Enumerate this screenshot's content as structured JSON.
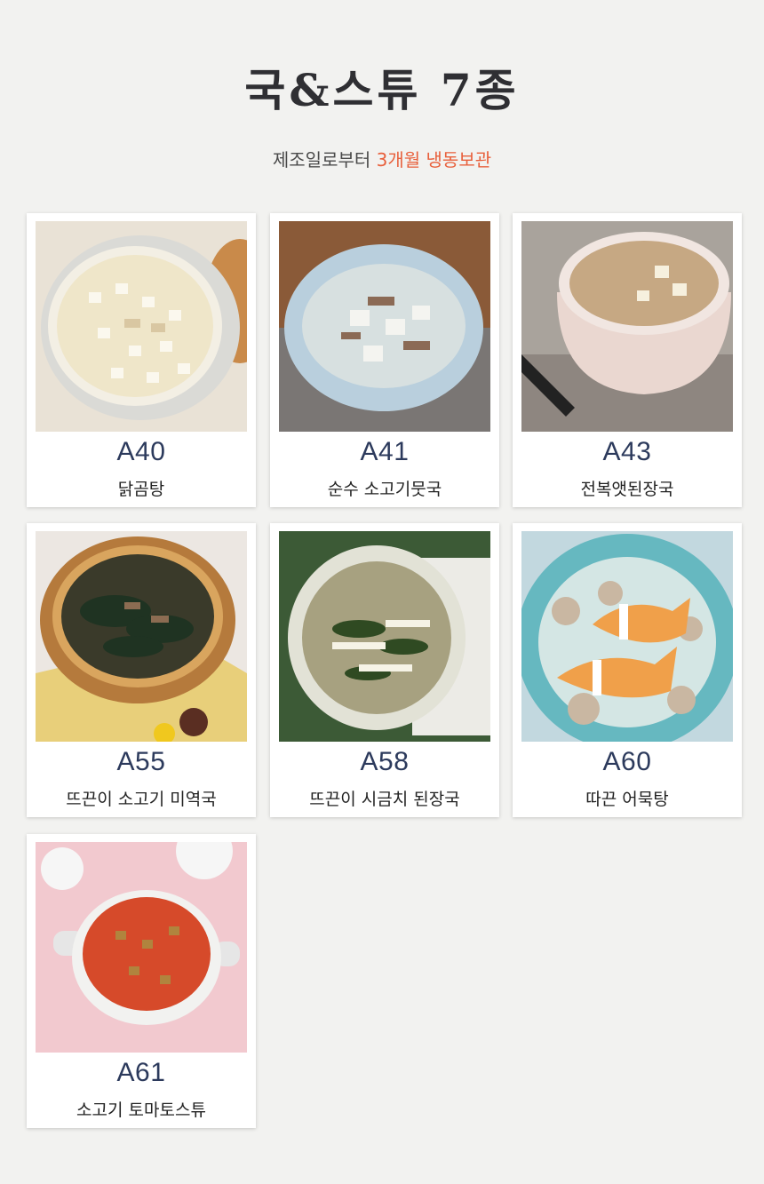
{
  "header": {
    "title": "국&스튜 7종",
    "subtitle_prefix": "제조일로부터 ",
    "subtitle_accent": "3개월 냉동보관",
    "accent_color": "#e8603c"
  },
  "products": [
    {
      "code": "A40",
      "name": "닭곰탕"
    },
    {
      "code": "A41",
      "name": "순수 소고기뭇국"
    },
    {
      "code": "A43",
      "name": "전복앳된장국"
    },
    {
      "code": "A55",
      "name": "뜨끈이 소고기 미역국"
    },
    {
      "code": "A58",
      "name": "뜨끈이 시금치 된장국"
    },
    {
      "code": "A60",
      "name": "따끈 어묵탕"
    },
    {
      "code": "A61",
      "name": "소고기 토마토스튜"
    }
  ]
}
